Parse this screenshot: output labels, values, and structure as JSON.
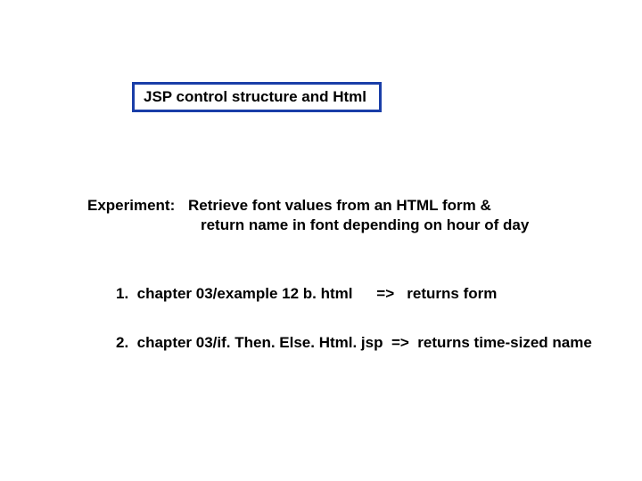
{
  "title": "JSP control structure and Html",
  "experiment": {
    "label": "Experiment:",
    "line1": "Retrieve font values from an HTML form &",
    "line2": "return name in font depending on hour of day"
  },
  "items": [
    {
      "num": "1.",
      "file": "chapter 03/example 12 b. html",
      "arrow": "=>",
      "desc": "returns form"
    },
    {
      "num": "2.",
      "file": "chapter 03/if. Then. Else. Html. jsp",
      "arrow": "=>",
      "desc": "returns time-sized name"
    }
  ]
}
